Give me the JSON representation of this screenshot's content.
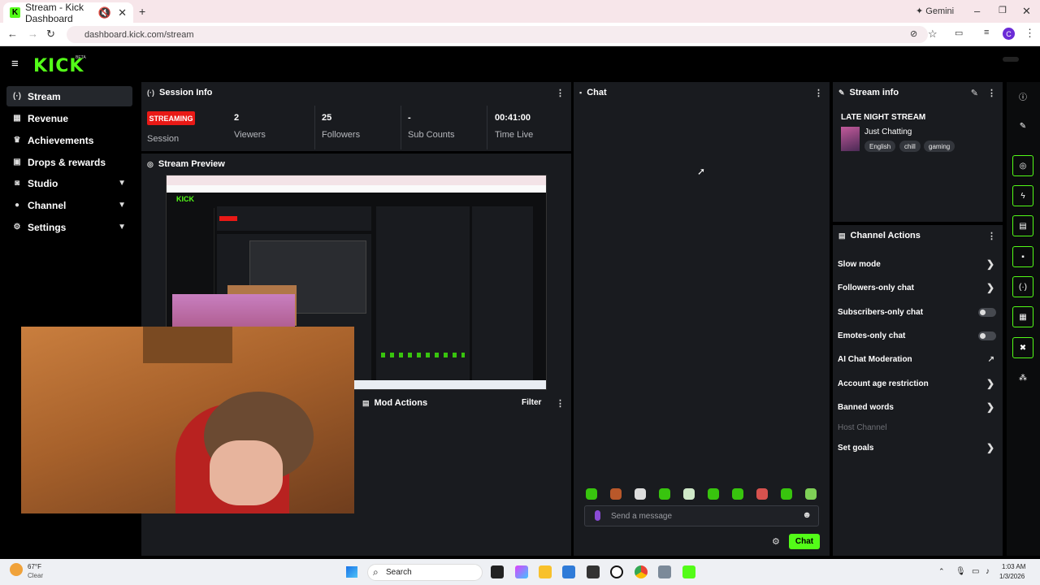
{
  "browser": {
    "tab_title": "Stream - Kick Dashboard",
    "tab_favicon": "K",
    "gemini_label": "Gemini",
    "url": "dashboard.kick.com/stream"
  },
  "app": {
    "logo": "KICK",
    "beta": "BETA"
  },
  "sidebar": {
    "items": [
      {
        "label": "Stream",
        "icon": "broadcast-icon"
      },
      {
        "label": "Revenue",
        "icon": "wallet-icon"
      },
      {
        "label": "Achievements",
        "icon": "trophy-icon"
      },
      {
        "label": "Drops & rewards",
        "icon": "gift-icon"
      },
      {
        "label": "Studio",
        "icon": "camera-icon"
      },
      {
        "label": "Channel",
        "icon": "user-icon"
      },
      {
        "label": "Settings",
        "icon": "gear-icon"
      }
    ]
  },
  "session": {
    "title": "Session Info",
    "badge": "STREAMING",
    "badge_label": "Session",
    "stats": [
      {
        "value": "2",
        "label": "Viewers"
      },
      {
        "value": "25",
        "label": "Followers"
      },
      {
        "value": "-",
        "label": "Sub Counts"
      },
      {
        "value": "00:41:00",
        "label": "Time Live"
      }
    ]
  },
  "preview": {
    "title": "Stream Preview"
  },
  "mod": {
    "title": "Mod Actions",
    "filter": "Filter"
  },
  "chat": {
    "title": "Chat",
    "placeholder": "Send a message",
    "send": "Chat"
  },
  "stream_info": {
    "title": "Stream info",
    "stream_title": "LATE NIGHT STREAM",
    "category": "Just Chatting",
    "tags": [
      "English",
      "chill",
      "gaming"
    ]
  },
  "channel_actions": {
    "title": "Channel Actions",
    "items": [
      {
        "label": "Slow mode",
        "control": "chevron"
      },
      {
        "label": "Followers-only chat",
        "control": "chevron"
      },
      {
        "label": "Subscribers-only chat",
        "control": "toggle",
        "on": false
      },
      {
        "label": "Emotes-only chat",
        "control": "toggle",
        "on": false
      },
      {
        "label": "AI Chat Moderation",
        "control": "external"
      },
      {
        "label": "Account age restriction",
        "control": "chevron"
      },
      {
        "label": "Banned words",
        "control": "chevron"
      },
      {
        "label": "Host Channel",
        "control": "none",
        "disabled": true
      },
      {
        "label": "Set goals",
        "control": "chevron"
      }
    ]
  },
  "taskbar": {
    "temp": "67°F",
    "weather": "Clear",
    "search": "Search",
    "time": "1:03 AM",
    "date": "1/3/2026"
  },
  "colors": {
    "accent": "#53fc18",
    "live": "#e91916",
    "panel": "#191b1f"
  }
}
